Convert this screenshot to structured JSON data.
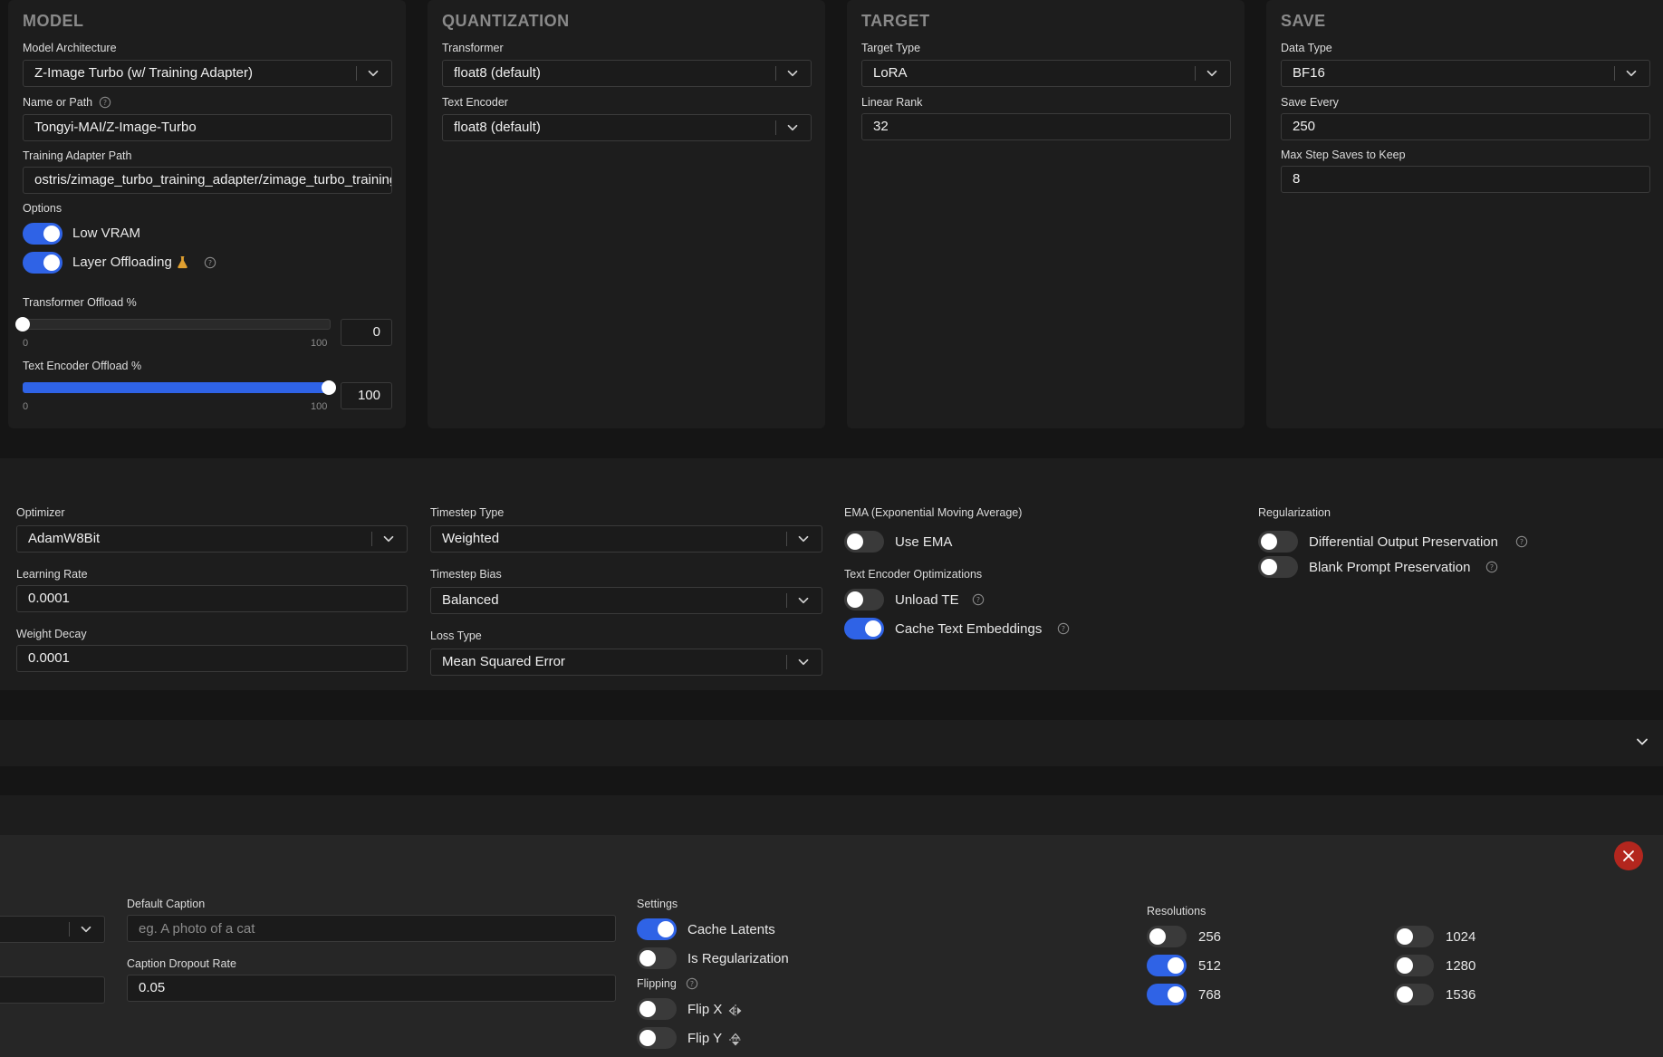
{
  "model": {
    "title": "MODEL",
    "architecture_label": "Model Architecture",
    "architecture_value": "Z-Image Turbo (w/ Training Adapter)",
    "name_label": "Name or Path",
    "name_value": "Tongyi-MAI/Z-Image-Turbo",
    "adapter_label": "Training Adapter Path",
    "adapter_value": "ostris/zimage_turbo_training_adapter/zimage_turbo_training_adapter",
    "options_label": "Options",
    "low_vram_label": "Low VRAM",
    "low_vram_on": true,
    "layer_offloading_label": "Layer Offloading",
    "layer_offloading_on": true,
    "transformer_offload_label": "Transformer Offload %",
    "transformer_offload_value": "0",
    "transformer_offload_min": "0",
    "transformer_offload_max": "100",
    "te_offload_label": "Text Encoder Offload %",
    "te_offload_value": "100",
    "te_offload_min": "0",
    "te_offload_max": "100"
  },
  "quantization": {
    "title": "QUANTIZATION",
    "transformer_label": "Transformer",
    "transformer_value": "float8 (default)",
    "te_label": "Text Encoder",
    "te_value": "float8 (default)"
  },
  "target": {
    "title": "TARGET",
    "type_label": "Target Type",
    "type_value": "LoRA",
    "rank_label": "Linear Rank",
    "rank_value": "32"
  },
  "save": {
    "title": "SAVE",
    "dtype_label": "Data Type",
    "dtype_value": "BF16",
    "every_label": "Save Every",
    "every_value": "250",
    "max_label": "Max Step Saves to Keep",
    "max_value": "8"
  },
  "training": {
    "optimizer_label": "Optimizer",
    "optimizer_value": "AdamW8Bit",
    "lr_label": "Learning Rate",
    "lr_value": "0.0001",
    "wd_label": "Weight Decay",
    "wd_value": "0.0001",
    "timestep_type_label": "Timestep Type",
    "timestep_type_value": "Weighted",
    "timestep_bias_label": "Timestep Bias",
    "timestep_bias_value": "Balanced",
    "loss_label": "Loss Type",
    "loss_value": "Mean Squared Error",
    "ema_label": "EMA (Exponential Moving Average)",
    "use_ema_label": "Use EMA",
    "use_ema_on": false,
    "te_opt_label": "Text Encoder Optimizations",
    "unload_te_label": "Unload TE",
    "unload_te_on": false,
    "cache_te_label": "Cache Text Embeddings",
    "cache_te_on": true,
    "reg_label": "Regularization",
    "dop_label": "Differential Output Preservation",
    "dop_on": false,
    "bpp_label": "Blank Prompt Preservation",
    "bpp_on": false
  },
  "dataset": {
    "default_caption_label": "Default Caption",
    "default_caption_placeholder": "eg. A photo of a cat",
    "caption_dropout_label": "Caption Dropout Rate",
    "caption_dropout_value": "0.05",
    "settings_label": "Settings",
    "cache_latents_label": "Cache Latents",
    "cache_latents_on": true,
    "is_reg_label": "Is Regularization",
    "is_reg_on": false,
    "flipping_label": "Flipping",
    "flip_x_label": "Flip X",
    "flip_x_on": false,
    "flip_y_label": "Flip Y",
    "flip_y_on": false,
    "resolutions_label": "Resolutions",
    "resolutions": [
      {
        "label": "256",
        "on": false
      },
      {
        "label": "512",
        "on": true
      },
      {
        "label": "768",
        "on": true
      },
      {
        "label": "1024",
        "on": false
      },
      {
        "label": "1280",
        "on": false
      },
      {
        "label": "1536",
        "on": false
      }
    ]
  },
  "colors": {
    "accent": "#2f63e6",
    "danger": "#b3261e",
    "panel": "#1d1d1d",
    "background": "#151515"
  }
}
